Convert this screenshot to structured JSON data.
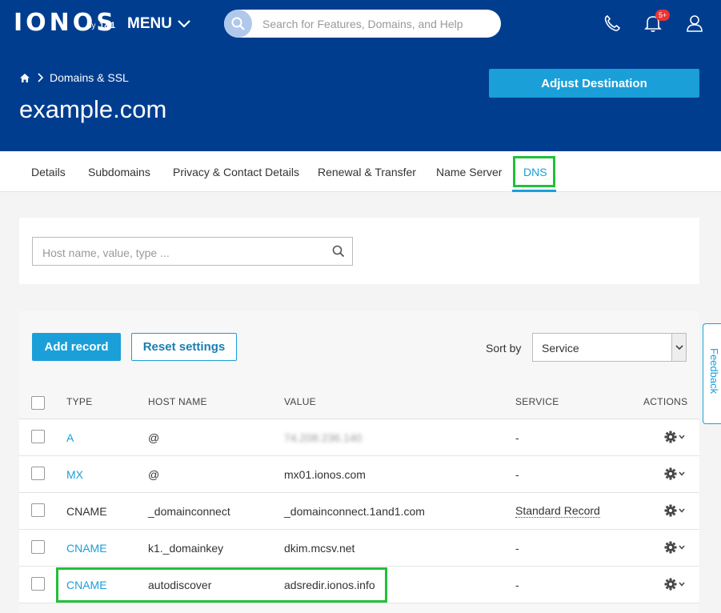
{
  "topbar": {
    "logo": "IONOS",
    "logo_by": "by",
    "logo_brand": "1&1",
    "menu_label": "MENU",
    "search_placeholder": "Search for Features, Domains, and Help",
    "notification_badge": "5+"
  },
  "header": {
    "breadcrumb": "Domains & SSL",
    "domain": "example.com",
    "adjust_button": "Adjust Destination"
  },
  "tabs": [
    {
      "label": "Details"
    },
    {
      "label": "Subdomains"
    },
    {
      "label": "Privacy & Contact Details"
    },
    {
      "label": "Renewal & Transfer"
    },
    {
      "label": "Name Server"
    },
    {
      "label": "DNS",
      "active": true
    }
  ],
  "filter": {
    "placeholder": "Host name, value, type ..."
  },
  "toolbar": {
    "add_record": "Add record",
    "reset_settings": "Reset settings",
    "sort_label": "Sort by",
    "sort_value": "Service"
  },
  "table": {
    "headers": {
      "type": "TYPE",
      "host": "HOST NAME",
      "value": "VALUE",
      "service": "SERVICE",
      "actions": "ACTIONS"
    },
    "rows": [
      {
        "type": "A",
        "host": "@",
        "value": "74.208.236.140",
        "service": "-"
      },
      {
        "type": "MX",
        "host": "@",
        "value": "mx01.ionos.com",
        "service": "-"
      },
      {
        "type": "CNAME",
        "host": "_domainconnect",
        "value": "_domainconnect.1and1.com",
        "service": "Standard Record"
      },
      {
        "type": "CNAME",
        "host": "k1._domainkey",
        "value": "dkim.mcsv.net",
        "service": "-"
      },
      {
        "type": "CNAME",
        "host": "autodiscover",
        "value": "adsredir.ionos.info",
        "service": "-"
      }
    ]
  },
  "feedback": "Feedback",
  "colors": {
    "brand_blue": "#003d8f",
    "accent": "#1a9fd9",
    "highlight": "#22c03a"
  }
}
